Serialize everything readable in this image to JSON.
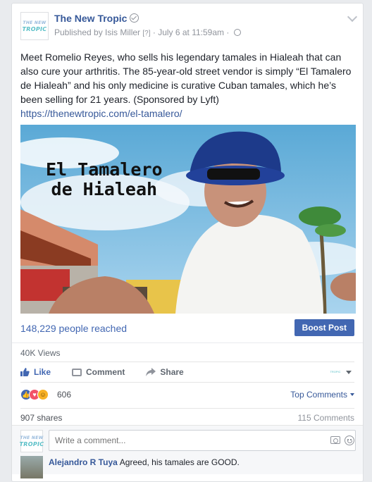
{
  "post": {
    "page_name": "The New Tropic",
    "logo_text": "TROPIC",
    "logo_top": "THE NEW",
    "published_by": "Published by Isis Miller",
    "help_marker": "[?]",
    "date": "· July 6 at 11:59am ·",
    "text": "Meet Romelio Reyes, who sells his legendary tamales in Hialeah that can also cure your arthritis. The 85-year-old street vendor is simply “El Tamalero de Hialeah” and his only medicine is curative Cuban tamales, which he’s been selling for 21 years. (Sponsored by Lyft)",
    "link": "https://thenewtropic.com/el-tamalero/",
    "video_title_line1": "El Tamalero",
    "video_title_line2": "de Hialeah"
  },
  "insights": {
    "reach": "148,229 people reached",
    "boost_label": "Boost Post",
    "views": "40K Views"
  },
  "actions": {
    "like": "Like",
    "comment": "Comment",
    "share": "Share"
  },
  "engagement": {
    "reaction_count": "606",
    "top_comments": "Top Comments",
    "shares": "907 shares",
    "comments": "115 Comments"
  },
  "comment_box": {
    "placeholder": "Write a comment..."
  },
  "comments": [
    {
      "author": "Alejandro R Tuya",
      "text": "Agreed, his tamales are GOOD."
    }
  ],
  "colors": {
    "link": "#365899",
    "accent": "#4267b2",
    "love": "#f25268",
    "haha": "#f7b125"
  }
}
